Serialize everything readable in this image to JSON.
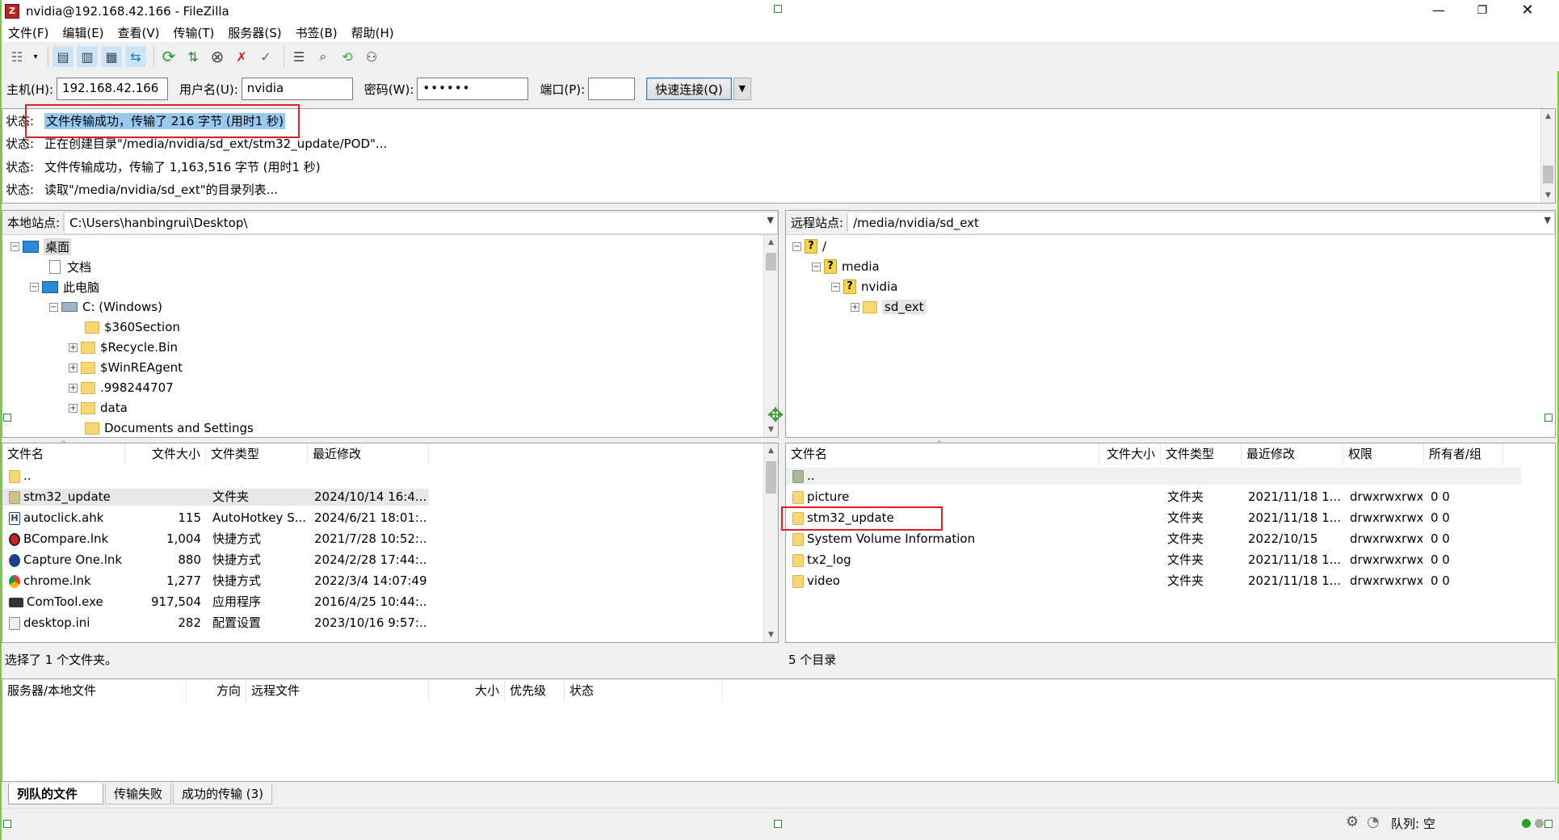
{
  "window": {
    "title": "nvidia@192.168.42.166 - FileZilla",
    "app_icon_letter": "Z",
    "accent_border": "#6fcf3f"
  },
  "menu": [
    "文件(F)",
    "编辑(E)",
    "查看(V)",
    "传输(T)",
    "服务器(S)",
    "书签(B)",
    "帮助(H)"
  ],
  "toolbar_icons": [
    "site-manager-icon",
    "dropdown-icon",
    "toggle-log-icon",
    "toggle-local-tree-icon",
    "toggle-remote-tree-icon",
    "toggle-queue-icon",
    "refresh-icon",
    "process-queue-icon",
    "cancel-icon",
    "disconnect-icon",
    "reconnect-icon",
    "filter-icon",
    "search-icon",
    "compare-icon",
    "binoculars-icon"
  ],
  "quickconnect": {
    "host_label": "主机(H):",
    "host_value": "192.168.42.166",
    "user_label": "用户名(U):",
    "user_value": "nvidia",
    "pass_label": "密码(W):",
    "pass_value": "••••••",
    "port_label": "端口(P):",
    "port_value": "",
    "connect_label": "快速连接(Q)"
  },
  "log": [
    {
      "label": "状态:",
      "text": "文件传输成功，传输了 216 字节 (用时1 秒)"
    },
    {
      "label": "状态:",
      "text": "正在创建目录\"/media/nvidia/sd_ext/stm32_update/POD\"..."
    },
    {
      "label": "状态:",
      "text": "文件传输成功，传输了 1,163,516 字节 (用时1 秒)"
    },
    {
      "label": "状态:",
      "text": "读取\"/media/nvidia/sd_ext\"的目录列表..."
    }
  ],
  "local": {
    "site_label": "本地站点:",
    "site_path": "C:\\Users\\hanbingrui\\Desktop\\",
    "tree": [
      {
        "label": "桌面"
      },
      {
        "label": "文档"
      },
      {
        "label": "此电脑"
      },
      {
        "label": "C: (Windows)"
      },
      {
        "label": "$360Section"
      },
      {
        "label": "$Recycle.Bin"
      },
      {
        "label": "$WinREAgent"
      },
      {
        "label": ".998244707"
      },
      {
        "label": "data"
      },
      {
        "label": "Documents and Settings"
      }
    ],
    "columns": [
      "文件名",
      "文件大小",
      "文件类型",
      "最近修改"
    ],
    "files": [
      {
        "name": "..",
        "size": "",
        "type": "",
        "modified": ""
      },
      {
        "name": "stm32_update",
        "size": "",
        "type": "文件夹",
        "modified": "2024/10/14 16:4..."
      },
      {
        "name": "autoclick.ahk",
        "size": "115",
        "type": "AutoHotkey S...",
        "modified": "2024/6/21 18:01:..."
      },
      {
        "name": "BCompare.lnk",
        "size": "1,004",
        "type": "快捷方式",
        "modified": "2021/7/28 10:52:..."
      },
      {
        "name": "Capture One.lnk",
        "size": "880",
        "type": "快捷方式",
        "modified": "2024/2/28 17:44:..."
      },
      {
        "name": "chrome.lnk",
        "size": "1,277",
        "type": "快捷方式",
        "modified": "2022/3/4 14:07:49"
      },
      {
        "name": "ComTool.exe",
        "size": "917,504",
        "type": "应用程序",
        "modified": "2016/4/25 10:44:..."
      },
      {
        "name": "desktop.ini",
        "size": "282",
        "type": "配置设置",
        "modified": "2023/10/16 9:57:..."
      }
    ],
    "status": "选择了 1 个文件夹。"
  },
  "remote": {
    "site_label": "远程站点:",
    "site_path": "/media/nvidia/sd_ext",
    "tree": [
      {
        "label": "/"
      },
      {
        "label": "media"
      },
      {
        "label": "nvidia"
      },
      {
        "label": "sd_ext"
      }
    ],
    "columns": [
      "文件名",
      "文件大小",
      "文件类型",
      "最近修改",
      "权限",
      "所有者/组"
    ],
    "files": [
      {
        "name": "..",
        "size": "",
        "type": "",
        "modified": "",
        "perm": "",
        "owner": ""
      },
      {
        "name": "picture",
        "size": "",
        "type": "文件夹",
        "modified": "2021/11/18 1...",
        "perm": "drwxrwxrwx",
        "owner": "0 0"
      },
      {
        "name": "stm32_update",
        "size": "",
        "type": "文件夹",
        "modified": "2021/11/18 1...",
        "perm": "drwxrwxrwx",
        "owner": "0 0"
      },
      {
        "name": "System Volume Information",
        "size": "",
        "type": "文件夹",
        "modified": "2022/10/15",
        "perm": "drwxrwxrwx",
        "owner": "0 0"
      },
      {
        "name": "tx2_log",
        "size": "",
        "type": "文件夹",
        "modified": "2021/11/18 1...",
        "perm": "drwxrwxrwx",
        "owner": "0 0"
      },
      {
        "name": "video",
        "size": "",
        "type": "文件夹",
        "modified": "2021/11/18 1...",
        "perm": "drwxrwxrwx",
        "owner": "0 0"
      }
    ],
    "status": "5 个目录"
  },
  "queue": {
    "columns": [
      "服务器/本地文件",
      "方向",
      "远程文件",
      "大小",
      "优先级",
      "状态"
    ],
    "tabs": [
      "列队的文件",
      "传输失败",
      "成功的传输 (3)"
    ]
  },
  "bottom": {
    "queue_status": "队列: 空"
  }
}
